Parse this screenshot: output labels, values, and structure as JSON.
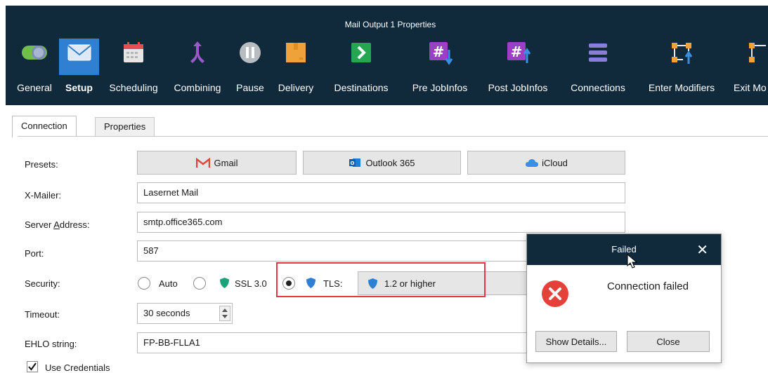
{
  "window": {
    "title": "Mail Output 1 Properties"
  },
  "toolbar": {
    "items": [
      {
        "label": "General",
        "icon": "toggle-icon"
      },
      {
        "label": "Setup",
        "icon": "envelope-icon"
      },
      {
        "label": "Scheduling",
        "icon": "calendar-icon"
      },
      {
        "label": "Combining",
        "icon": "merge-arrow-icon"
      },
      {
        "label": "Pause",
        "icon": "pause-icon"
      },
      {
        "label": "Delivery",
        "icon": "package-icon"
      },
      {
        "label": "Destinations",
        "icon": "arrow-right-icon"
      },
      {
        "label": "Pre JobInfos",
        "icon": "hash-down-icon"
      },
      {
        "label": "Post JobInfos",
        "icon": "hash-up-icon"
      },
      {
        "label": "Connections",
        "icon": "stack-icon"
      },
      {
        "label": "Enter Modifiers",
        "icon": "enter-modifier-icon"
      },
      {
        "label": "Exit Mo",
        "icon": "exit-modifier-icon"
      }
    ]
  },
  "tabs": [
    {
      "label": "Connection"
    },
    {
      "label": "Properties"
    }
  ],
  "form": {
    "presets_label": "Presets:",
    "presets": [
      {
        "label": "Gmail"
      },
      {
        "label": "Outlook 365"
      },
      {
        "label": "iCloud"
      }
    ],
    "xmailer_label": "X-Mailer:",
    "xmailer_value": "Lasernet Mail",
    "server_label_pre": "Server ",
    "server_label_ul": "A",
    "server_label_post": "ddress:",
    "server_value": "smtp.office365.com",
    "port_label": "Port:",
    "port_value": "587",
    "security_label": "Security:",
    "security_options": {
      "auto": "Auto",
      "ssl": "SSL 3.0",
      "tls": "TLS:"
    },
    "tls_version": "1.2 or higher",
    "timeout_label": "Timeout:",
    "timeout_value": "30 seconds",
    "ehlo_label": "EHLO string:",
    "ehlo_value": "FP-BB-FLLA1",
    "use_credentials_label": "Use Credentials"
  },
  "dialog": {
    "title": "Failed",
    "message": "Connection failed",
    "show_details": "Show Details...",
    "close": "Close"
  },
  "colors": {
    "titlebar": "#102a3c",
    "accent": "#2f80d3",
    "error": "#e5413b",
    "highlight": "#e0393e"
  }
}
